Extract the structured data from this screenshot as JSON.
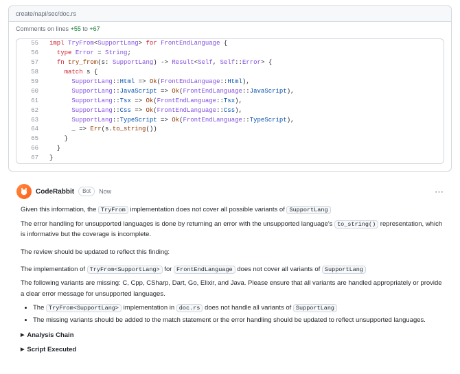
{
  "file_path": "create/napi/sec/doc.rs",
  "lines_bar": {
    "prefix": "Comments on lines",
    "from": "+55",
    "to_word": "to",
    "to": "+67"
  },
  "code": [
    {
      "n": "55",
      "tokens": [
        [
          "kw",
          "impl "
        ],
        [
          "ty",
          "TryFrom"
        ],
        [
          "op",
          "<"
        ],
        [
          "ty",
          "SupportLang"
        ],
        [
          "op",
          "> "
        ],
        [
          "kw",
          "for "
        ],
        [
          "ty",
          "FrontEndLanguage"
        ],
        [
          "op",
          " {"
        ]
      ]
    },
    {
      "n": "56",
      "tokens": [
        [
          "op",
          "  "
        ],
        [
          "kw",
          "type "
        ],
        [
          "ty",
          "Error"
        ],
        [
          "op",
          " = "
        ],
        [
          "ty",
          "String"
        ],
        [
          "op",
          ";"
        ]
      ]
    },
    {
      "n": "57",
      "tokens": [
        [
          "op",
          "  "
        ],
        [
          "kw",
          "fn "
        ],
        [
          "fn",
          "try_from"
        ],
        [
          "op",
          "(s: "
        ],
        [
          "ty",
          "SupportLang"
        ],
        [
          "op",
          ") -> "
        ],
        [
          "ty",
          "Result"
        ],
        [
          "op",
          "<"
        ],
        [
          "ty",
          "Self"
        ],
        [
          "op",
          ", "
        ],
        [
          "ty",
          "Self"
        ],
        [
          "op",
          "::"
        ],
        [
          "ty",
          "Error"
        ],
        [
          "op",
          "> {"
        ]
      ]
    },
    {
      "n": "58",
      "tokens": [
        [
          "op",
          "    "
        ],
        [
          "kw",
          "match"
        ],
        [
          "op",
          " s {"
        ]
      ]
    },
    {
      "n": "59",
      "tokens": [
        [
          "op",
          "      "
        ],
        [
          "ty",
          "SupportLang"
        ],
        [
          "op",
          "::"
        ],
        [
          "en",
          "Html"
        ],
        [
          "op",
          " => "
        ],
        [
          "fn",
          "Ok"
        ],
        [
          "op",
          "("
        ],
        [
          "ty",
          "FrontEndLanguage"
        ],
        [
          "op",
          "::"
        ],
        [
          "en",
          "Html"
        ],
        [
          "op",
          "),"
        ]
      ]
    },
    {
      "n": "60",
      "tokens": [
        [
          "op",
          "      "
        ],
        [
          "ty",
          "SupportLang"
        ],
        [
          "op",
          "::"
        ],
        [
          "en",
          "JavaScript"
        ],
        [
          "op",
          " => "
        ],
        [
          "fn",
          "Ok"
        ],
        [
          "op",
          "("
        ],
        [
          "ty",
          "FrontEndLanguage"
        ],
        [
          "op",
          "::"
        ],
        [
          "en",
          "JavaScript"
        ],
        [
          "op",
          "),"
        ]
      ]
    },
    {
      "n": "61",
      "tokens": [
        [
          "op",
          "      "
        ],
        [
          "ty",
          "SupportLang"
        ],
        [
          "op",
          "::"
        ],
        [
          "en",
          "Tsx"
        ],
        [
          "op",
          " => "
        ],
        [
          "fn",
          "Ok"
        ],
        [
          "op",
          "("
        ],
        [
          "ty",
          "FrontEndLanguage"
        ],
        [
          "op",
          "::"
        ],
        [
          "en",
          "Tsx"
        ],
        [
          "op",
          "),"
        ]
      ]
    },
    {
      "n": "62",
      "tokens": [
        [
          "op",
          "      "
        ],
        [
          "ty",
          "SupportLang"
        ],
        [
          "op",
          "::"
        ],
        [
          "en",
          "Css"
        ],
        [
          "op",
          " => "
        ],
        [
          "fn",
          "Ok"
        ],
        [
          "op",
          "("
        ],
        [
          "ty",
          "FrontEndLanguage"
        ],
        [
          "op",
          "::"
        ],
        [
          "en",
          "Css"
        ],
        [
          "op",
          "),"
        ]
      ]
    },
    {
      "n": "63",
      "tokens": [
        [
          "op",
          "      "
        ],
        [
          "ty",
          "SupportLang"
        ],
        [
          "op",
          "::"
        ],
        [
          "en",
          "TypeScript"
        ],
        [
          "op",
          " => "
        ],
        [
          "fn",
          "Ok"
        ],
        [
          "op",
          "("
        ],
        [
          "ty",
          "FrontEndLanguage"
        ],
        [
          "op",
          "::"
        ],
        [
          "en",
          "TypeScript"
        ],
        [
          "op",
          "),"
        ]
      ]
    },
    {
      "n": "64",
      "tokens": [
        [
          "op",
          "      _ => "
        ],
        [
          "fn",
          "Err"
        ],
        [
          "op",
          "(s."
        ],
        [
          "fn",
          "to_string"
        ],
        [
          "op",
          "())"
        ]
      ]
    },
    {
      "n": "65",
      "tokens": [
        [
          "op",
          "    }"
        ]
      ]
    },
    {
      "n": "66",
      "tokens": [
        [
          "op",
          "  }"
        ]
      ]
    },
    {
      "n": "67",
      "tokens": [
        [
          "op",
          "}"
        ]
      ]
    }
  ],
  "comment": {
    "author": "CodeRabbit",
    "badge": "Bot",
    "time": "Now",
    "p1a": "Given this information, the ",
    "c1": "TryFrom",
    "p1b": " implementation does not cover all possible variants of ",
    "c2": "SupportLang",
    "p2a": "The error handling for unsupported languages is done by returning an error with the unsupported language's ",
    "c3": "to_string()",
    "p2b": " representation, which is informative but the coverage is incomplete.",
    "p3": "The review should be updated to reflect this finding:",
    "p4a": "The implementation of ",
    "c4": "TryFrom<SupportLang>",
    "p4b": " for ",
    "c5": "FrontEndLanguage",
    "p4c": " does not cover all variants of ",
    "c6": "SupportLang",
    "p5": "The following variants are missing: C, Cpp, CSharp, Dart, Go, Elixir, and Java. Please ensure that all variants are handled appropriately or provide a clear error message for unsupported languages.",
    "b1a": "The ",
    "bc1": "TryFrom<SupportLang>",
    "b1b": " implementation in ",
    "bc2": "doc.rs",
    "b1c": " does not handle all variants of ",
    "bc3": "SupportLang",
    "b2": "The missing variants should be added to the match statement or the error handling should be updated to reflect unsupported languages.",
    "d1": "Analysis Chain",
    "d2": "Script Executed"
  }
}
